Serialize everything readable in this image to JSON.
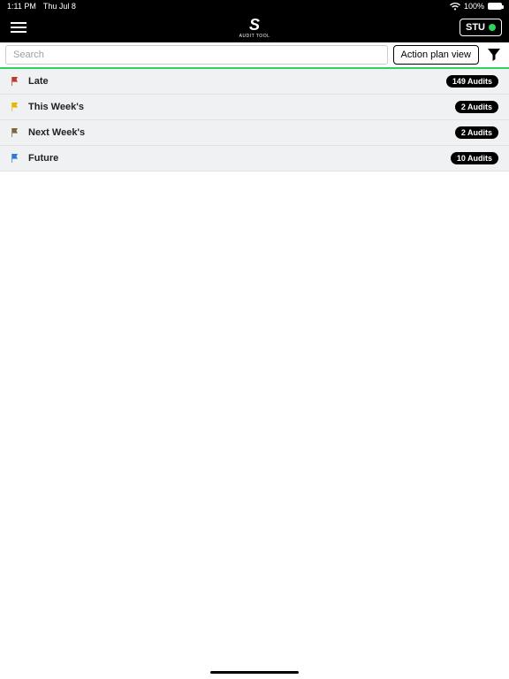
{
  "status": {
    "time": "1:11 PM",
    "date": "Thu Jul 8",
    "battery": "100%"
  },
  "app": {
    "logo_text": "S",
    "logo_sub": "AUDIT TOOL",
    "user_badge": "STU"
  },
  "search": {
    "placeholder": "Search",
    "action_plan_label": "Action plan view"
  },
  "rows": [
    {
      "label": "Late",
      "count": "149 Audits",
      "color": "#c0392b"
    },
    {
      "label": "This Week's",
      "count": "2 Audits",
      "color": "#e8b500"
    },
    {
      "label": "Next Week's",
      "count": "2 Audits",
      "color": "#7a6a3a"
    },
    {
      "label": "Future",
      "count": "10 Audits",
      "color": "#2a7bd6"
    }
  ]
}
